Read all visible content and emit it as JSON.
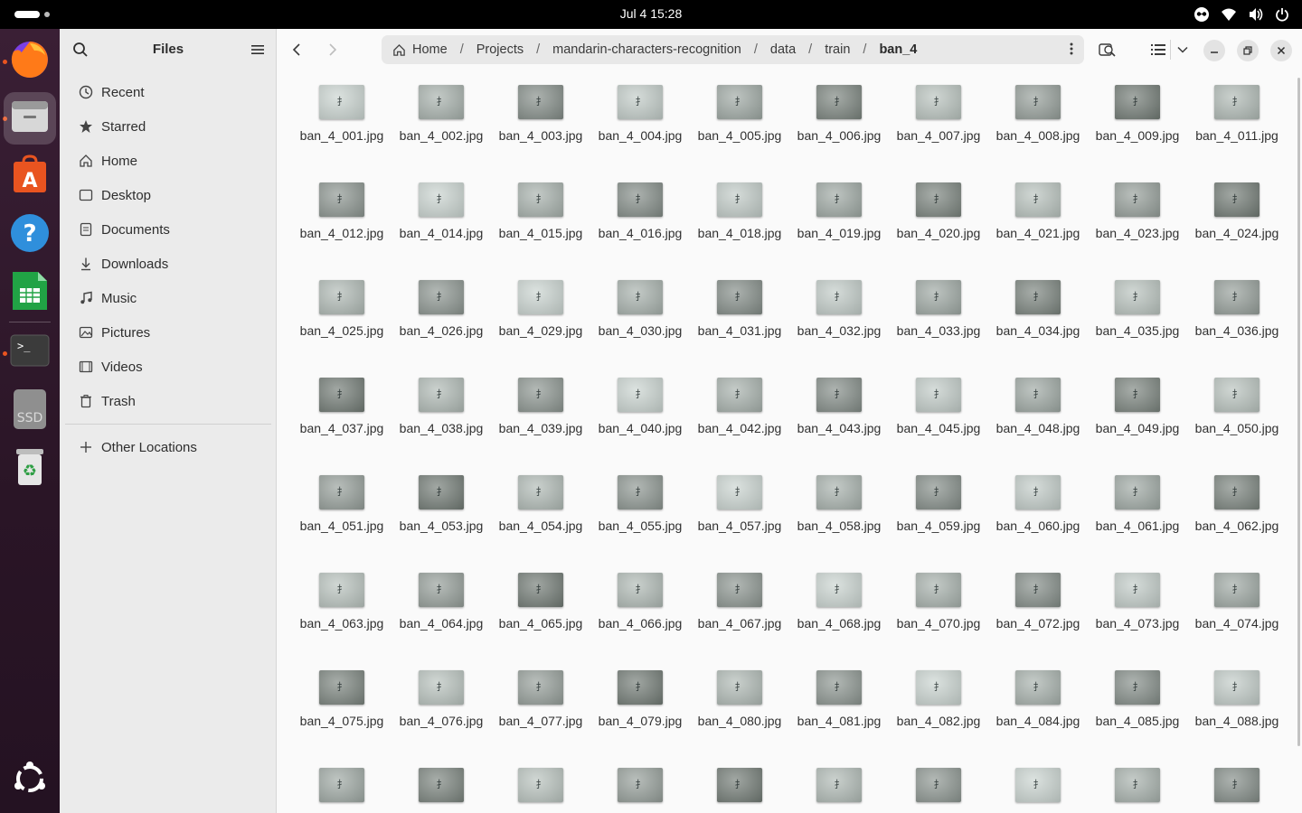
{
  "topbar": {
    "datetime": "Jul 4  15:28",
    "tray_icons": [
      "accessibility-icon",
      "wifi-icon",
      "volume-icon",
      "power-icon"
    ]
  },
  "dock": {
    "apps": [
      {
        "name": "firefox",
        "icon": "firefox-icon",
        "running": true
      },
      {
        "name": "files",
        "icon": "files-icon",
        "running": true,
        "active": true
      },
      {
        "name": "app-center",
        "icon": "app-center-icon",
        "running": false
      },
      {
        "name": "help",
        "icon": "help-icon",
        "running": false
      },
      {
        "name": "libreoffice-calc",
        "icon": "spreadsheet-icon",
        "running": false
      },
      {
        "name": "terminal",
        "icon": "terminal-icon",
        "running": true
      },
      {
        "name": "ssd",
        "icon": "drive-icon",
        "label": "SSD",
        "running": false
      },
      {
        "name": "trash",
        "icon": "trash-icon",
        "running": false
      },
      {
        "name": "show-apps",
        "icon": "ubuntu-icon",
        "running": false
      }
    ]
  },
  "sidebar": {
    "title": "Files",
    "places": [
      {
        "label": "Recent",
        "icon": "clock-icon"
      },
      {
        "label": "Starred",
        "icon": "star-icon"
      },
      {
        "label": "Home",
        "icon": "home-icon"
      },
      {
        "label": "Desktop",
        "icon": "desktop-icon"
      },
      {
        "label": "Documents",
        "icon": "document-icon"
      },
      {
        "label": "Downloads",
        "icon": "download-icon"
      },
      {
        "label": "Music",
        "icon": "music-icon"
      },
      {
        "label": "Pictures",
        "icon": "picture-icon"
      },
      {
        "label": "Videos",
        "icon": "video-icon"
      },
      {
        "label": "Trash",
        "icon": "trash-icon"
      }
    ],
    "other_locations": "Other Locations"
  },
  "pathbar": {
    "crumbs": [
      "Home",
      "Projects",
      "mandarin-characters-recognition",
      "data",
      "train",
      "ban_4"
    ]
  },
  "files": [
    "ban_4_001.jpg",
    "ban_4_002.jpg",
    "ban_4_003.jpg",
    "ban_4_004.jpg",
    "ban_4_005.jpg",
    "ban_4_006.jpg",
    "ban_4_007.jpg",
    "ban_4_008.jpg",
    "ban_4_009.jpg",
    "ban_4_011.jpg",
    "ban_4_012.jpg",
    "ban_4_014.jpg",
    "ban_4_015.jpg",
    "ban_4_016.jpg",
    "ban_4_018.jpg",
    "ban_4_019.jpg",
    "ban_4_020.jpg",
    "ban_4_021.jpg",
    "ban_4_023.jpg",
    "ban_4_024.jpg",
    "ban_4_025.jpg",
    "ban_4_026.jpg",
    "ban_4_029.jpg",
    "ban_4_030.jpg",
    "ban_4_031.jpg",
    "ban_4_032.jpg",
    "ban_4_033.jpg",
    "ban_4_034.jpg",
    "ban_4_035.jpg",
    "ban_4_036.jpg",
    "ban_4_037.jpg",
    "ban_4_038.jpg",
    "ban_4_039.jpg",
    "ban_4_040.jpg",
    "ban_4_042.jpg",
    "ban_4_043.jpg",
    "ban_4_045.jpg",
    "ban_4_048.jpg",
    "ban_4_049.jpg",
    "ban_4_050.jpg",
    "ban_4_051.jpg",
    "ban_4_053.jpg",
    "ban_4_054.jpg",
    "ban_4_055.jpg",
    "ban_4_057.jpg",
    "ban_4_058.jpg",
    "ban_4_059.jpg",
    "ban_4_060.jpg",
    "ban_4_061.jpg",
    "ban_4_062.jpg",
    "ban_4_063.jpg",
    "ban_4_064.jpg",
    "ban_4_065.jpg",
    "ban_4_066.jpg",
    "ban_4_067.jpg",
    "ban_4_068.jpg",
    "ban_4_070.jpg",
    "ban_4_072.jpg",
    "ban_4_073.jpg",
    "ban_4_074.jpg",
    "ban_4_075.jpg",
    "ban_4_076.jpg",
    "ban_4_077.jpg",
    "ban_4_079.jpg",
    "ban_4_080.jpg",
    "ban_4_081.jpg",
    "ban_4_082.jpg",
    "ban_4_084.jpg",
    "ban_4_085.jpg",
    "ban_4_088.jpg"
  ],
  "partial_row_count": 10,
  "colors": {
    "accent": "#e95420",
    "thumb_light": "#c9d3cf",
    "thumb_dark": "#6f7872"
  }
}
